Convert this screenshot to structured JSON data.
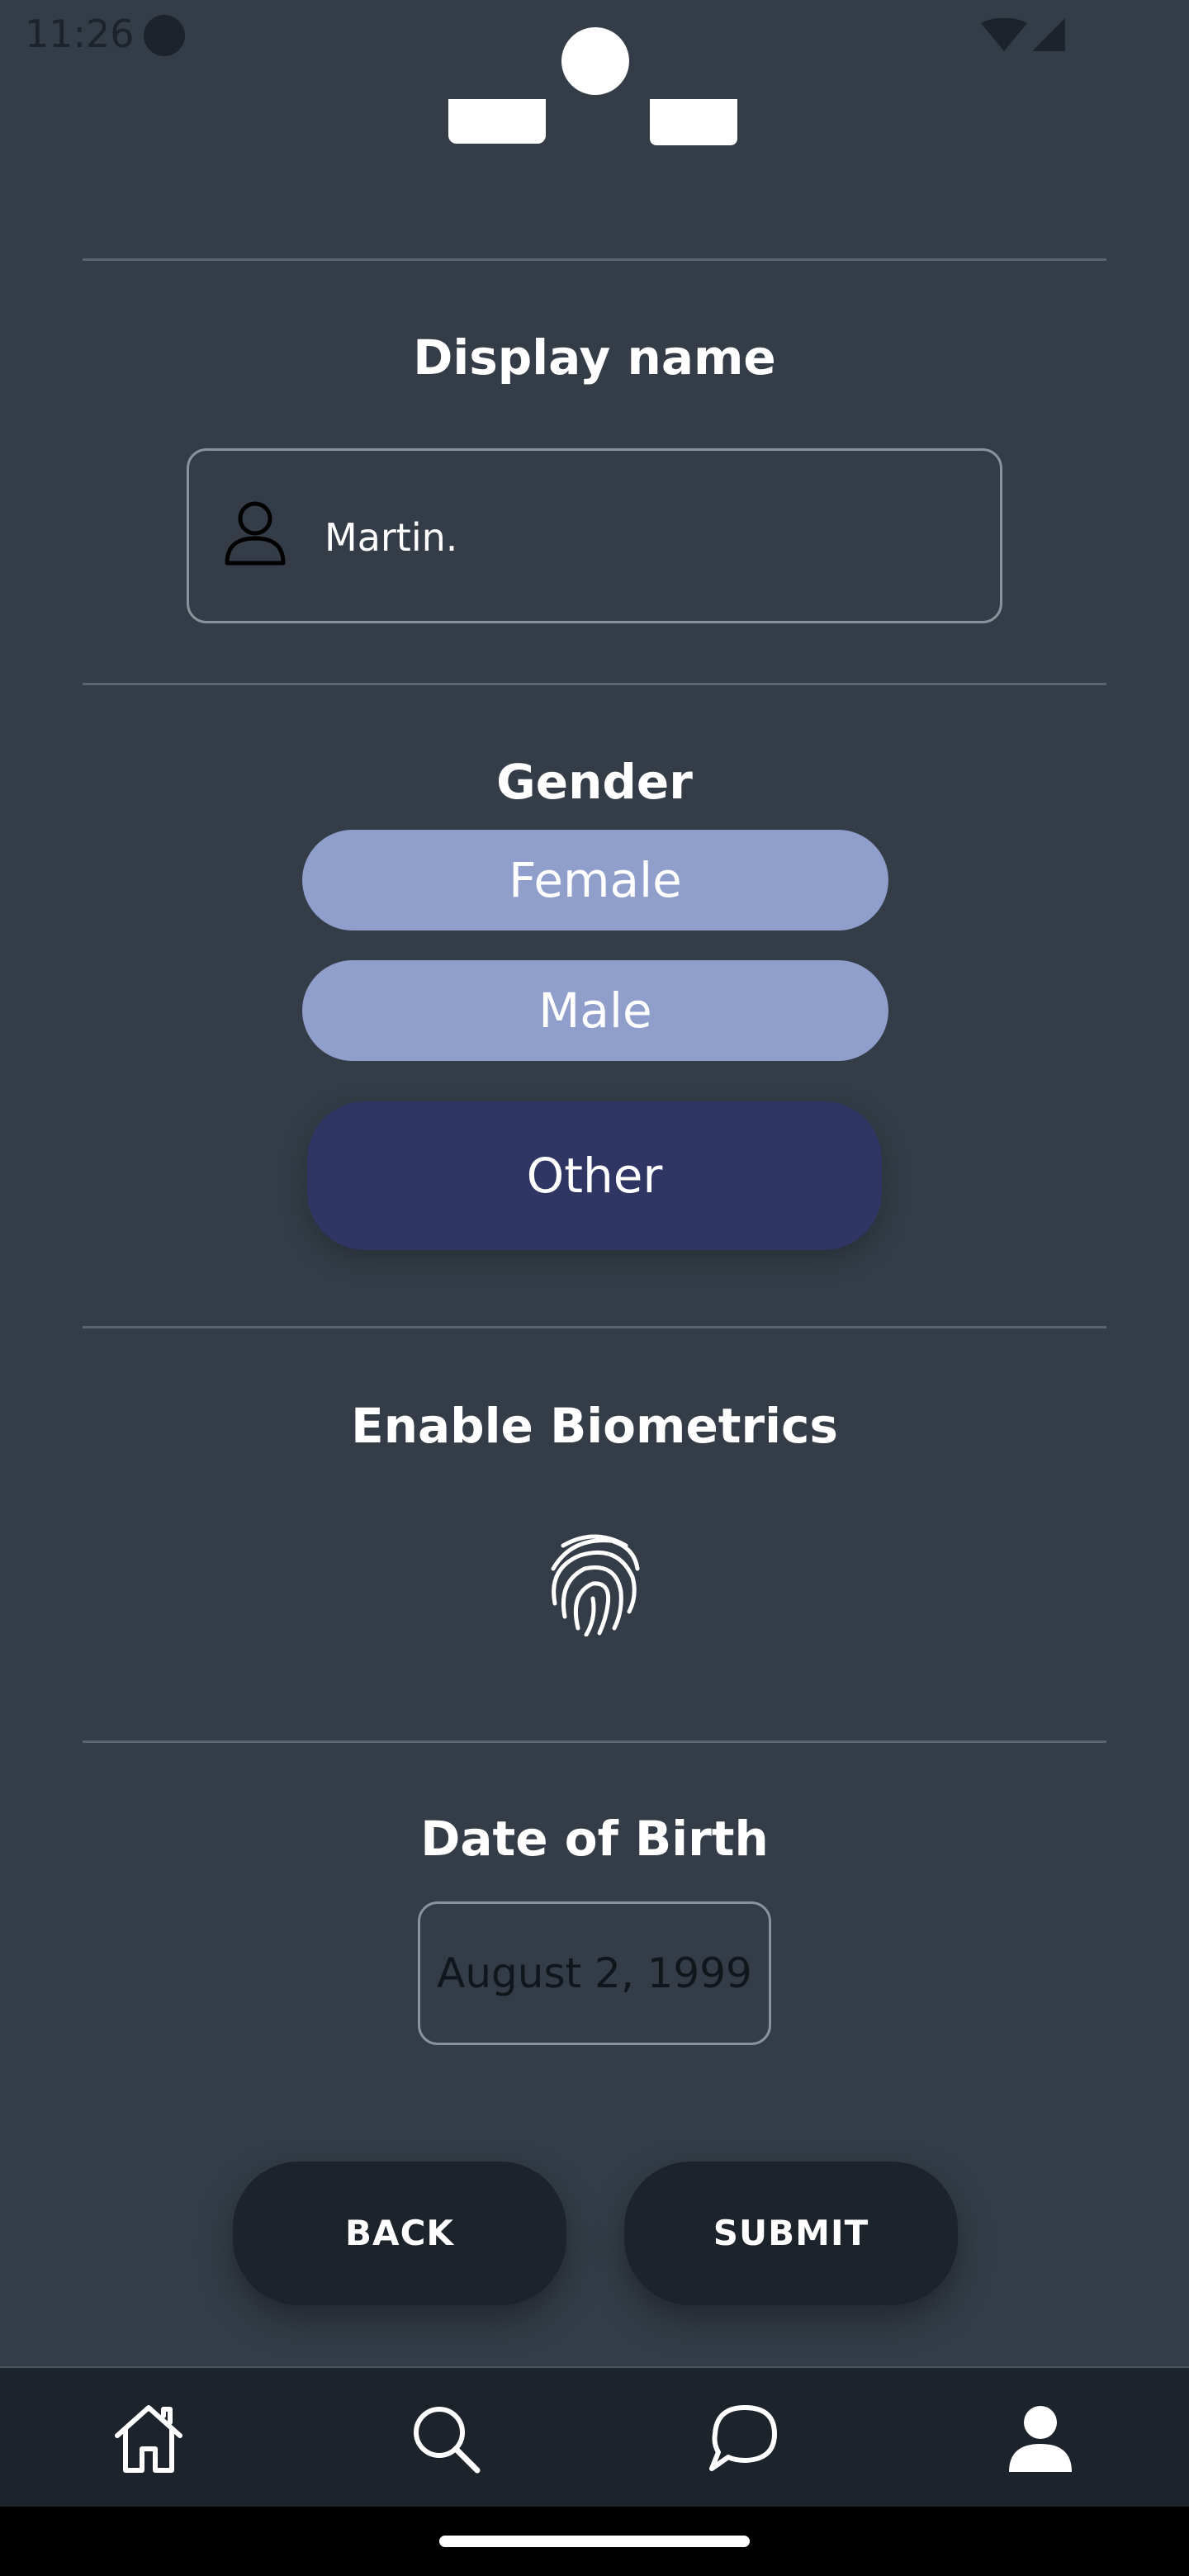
{
  "status_bar": {
    "time": "11:26"
  },
  "profile": {
    "display_name": {
      "title": "Display name",
      "value": "Martin."
    },
    "gender": {
      "title": "Gender",
      "options": [
        "Female",
        "Male",
        "Other"
      ],
      "selected": "Other"
    },
    "biometrics": {
      "title": "Enable Biometrics",
      "icon": "fingerprint-icon"
    },
    "date_of_birth": {
      "title": "Date of Birth",
      "value": "August 2, 1999"
    }
  },
  "actions": {
    "back_label": "BACK",
    "submit_label": "SUBMIT"
  },
  "bottom_nav": {
    "items": [
      {
        "icon": "home-icon"
      },
      {
        "icon": "search-icon"
      },
      {
        "icon": "chat-icon"
      },
      {
        "icon": "profile-icon",
        "active": true
      }
    ]
  },
  "colors": {
    "background": "#343d47",
    "pill_unselected": "#8f9ecb",
    "pill_selected": "#2f3663",
    "nav_background": "#1c232b"
  }
}
